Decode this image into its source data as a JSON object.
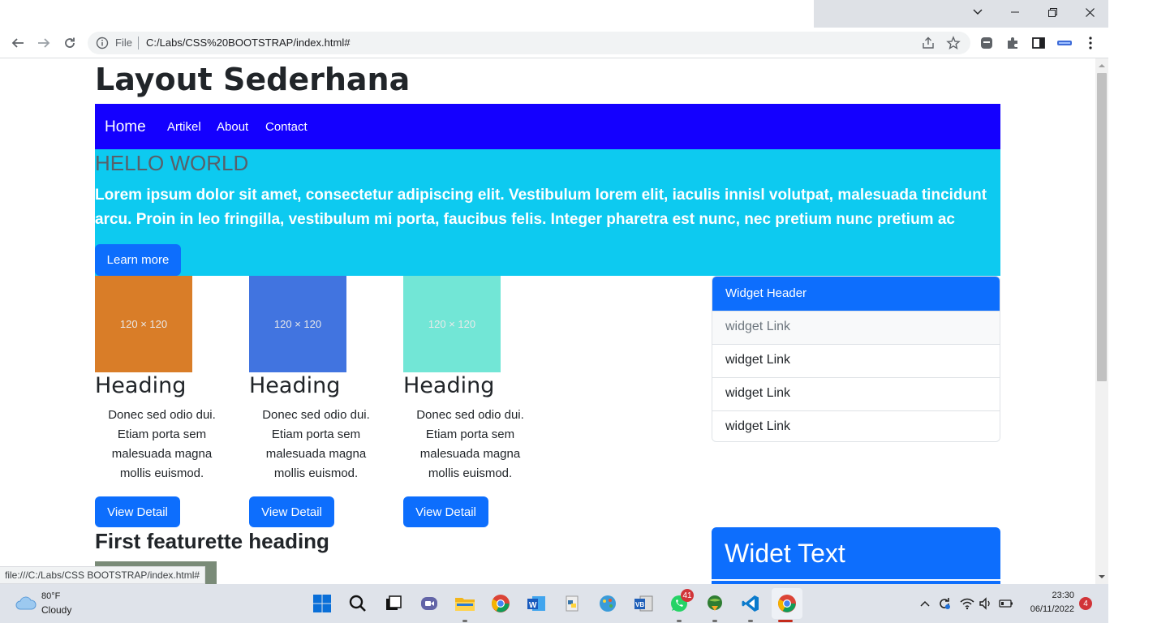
{
  "browser": {
    "file_label": "File",
    "url": "C:/Labs/CSS%20BOOTSTRAP/index.html#",
    "status_url": "file:///C:/Labs/CSS BOOTSTRAP/index.html#"
  },
  "page": {
    "title": "Layout Sederhana",
    "navbar": {
      "brand": "Home",
      "links": [
        "Artikel",
        "About",
        "Contact"
      ],
      "background": "#1400ff"
    },
    "hero": {
      "heading": "HELLO WORLD",
      "text": "Lorem ipsum dolor sit amet, consectetur adipiscing elit. Vestibulum lorem elit, iaculis innisl volutpat, malesuada tincidunt arcu. Proin in leo fringilla, vestibulum mi porta, faucibus felis. Integer pharetra est nunc, nec pretium nunc pretium ac",
      "button": "Learn more",
      "background": "#0dcaf0"
    },
    "cards": [
      {
        "image_label": "120 × 120",
        "image_color": "#d97d28",
        "heading": "Heading",
        "text": "Donec sed odio dui. Etiam porta sem malesuada magna mollis euismod.",
        "button": "View Detail"
      },
      {
        "image_label": "120 × 120",
        "image_color": "#4174e0",
        "heading": "Heading",
        "text": "Donec sed odio dui. Etiam porta sem malesuada magna mollis euismod.",
        "button": "View Detail"
      },
      {
        "image_label": "120 × 120",
        "image_color": "#72e6d6",
        "heading": "Heading",
        "text": "Donec sed odio dui. Etiam porta sem malesuada magna mollis euismod.",
        "button": "View Detail"
      }
    ],
    "widget": {
      "header": "Widget Header",
      "links": [
        "widget Link",
        "widget Link",
        "widget Link",
        "widget Link"
      ]
    },
    "featurette_heading": "First featurette heading",
    "widet_text": "Widet Text",
    "primary_color": "#0d6efd"
  },
  "taskbar": {
    "weather_temp": "80°F",
    "weather_condition": "Cloudy",
    "time": "23:30",
    "date": "06/11/2022",
    "whatsapp_badge": "41",
    "notification_badge": "4"
  }
}
